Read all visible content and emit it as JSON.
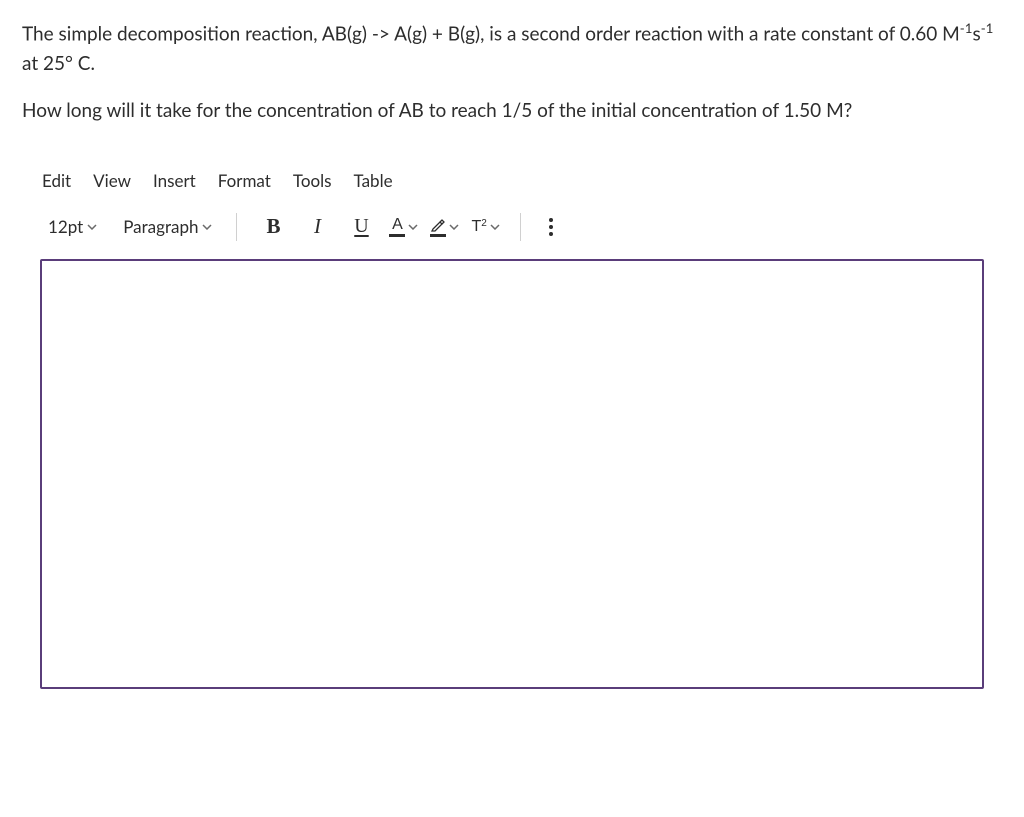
{
  "question": {
    "paragraph1_prefix": "The simple decomposition reaction, AB(g) -> A(g) + B(g), is a second order reaction with a rate constant of 0.60 M",
    "paragraph1_sup": "-1",
    "paragraph1_mid": "s",
    "paragraph1_sup2": "-1",
    "paragraph1_suffix": " at 25° C.",
    "paragraph2": "How long will it take for the concentration of AB to reach 1/5 of the initial concentration of 1.50 M?"
  },
  "menu": {
    "edit": "Edit",
    "view": "View",
    "insert": "Insert",
    "format": "Format",
    "tools": "Tools",
    "table": "Table"
  },
  "toolbar": {
    "fontSize": "12pt",
    "paragraphStyle": "Paragraph",
    "textColorLetter": "A",
    "superscriptT": "T",
    "superscript2": "2"
  }
}
